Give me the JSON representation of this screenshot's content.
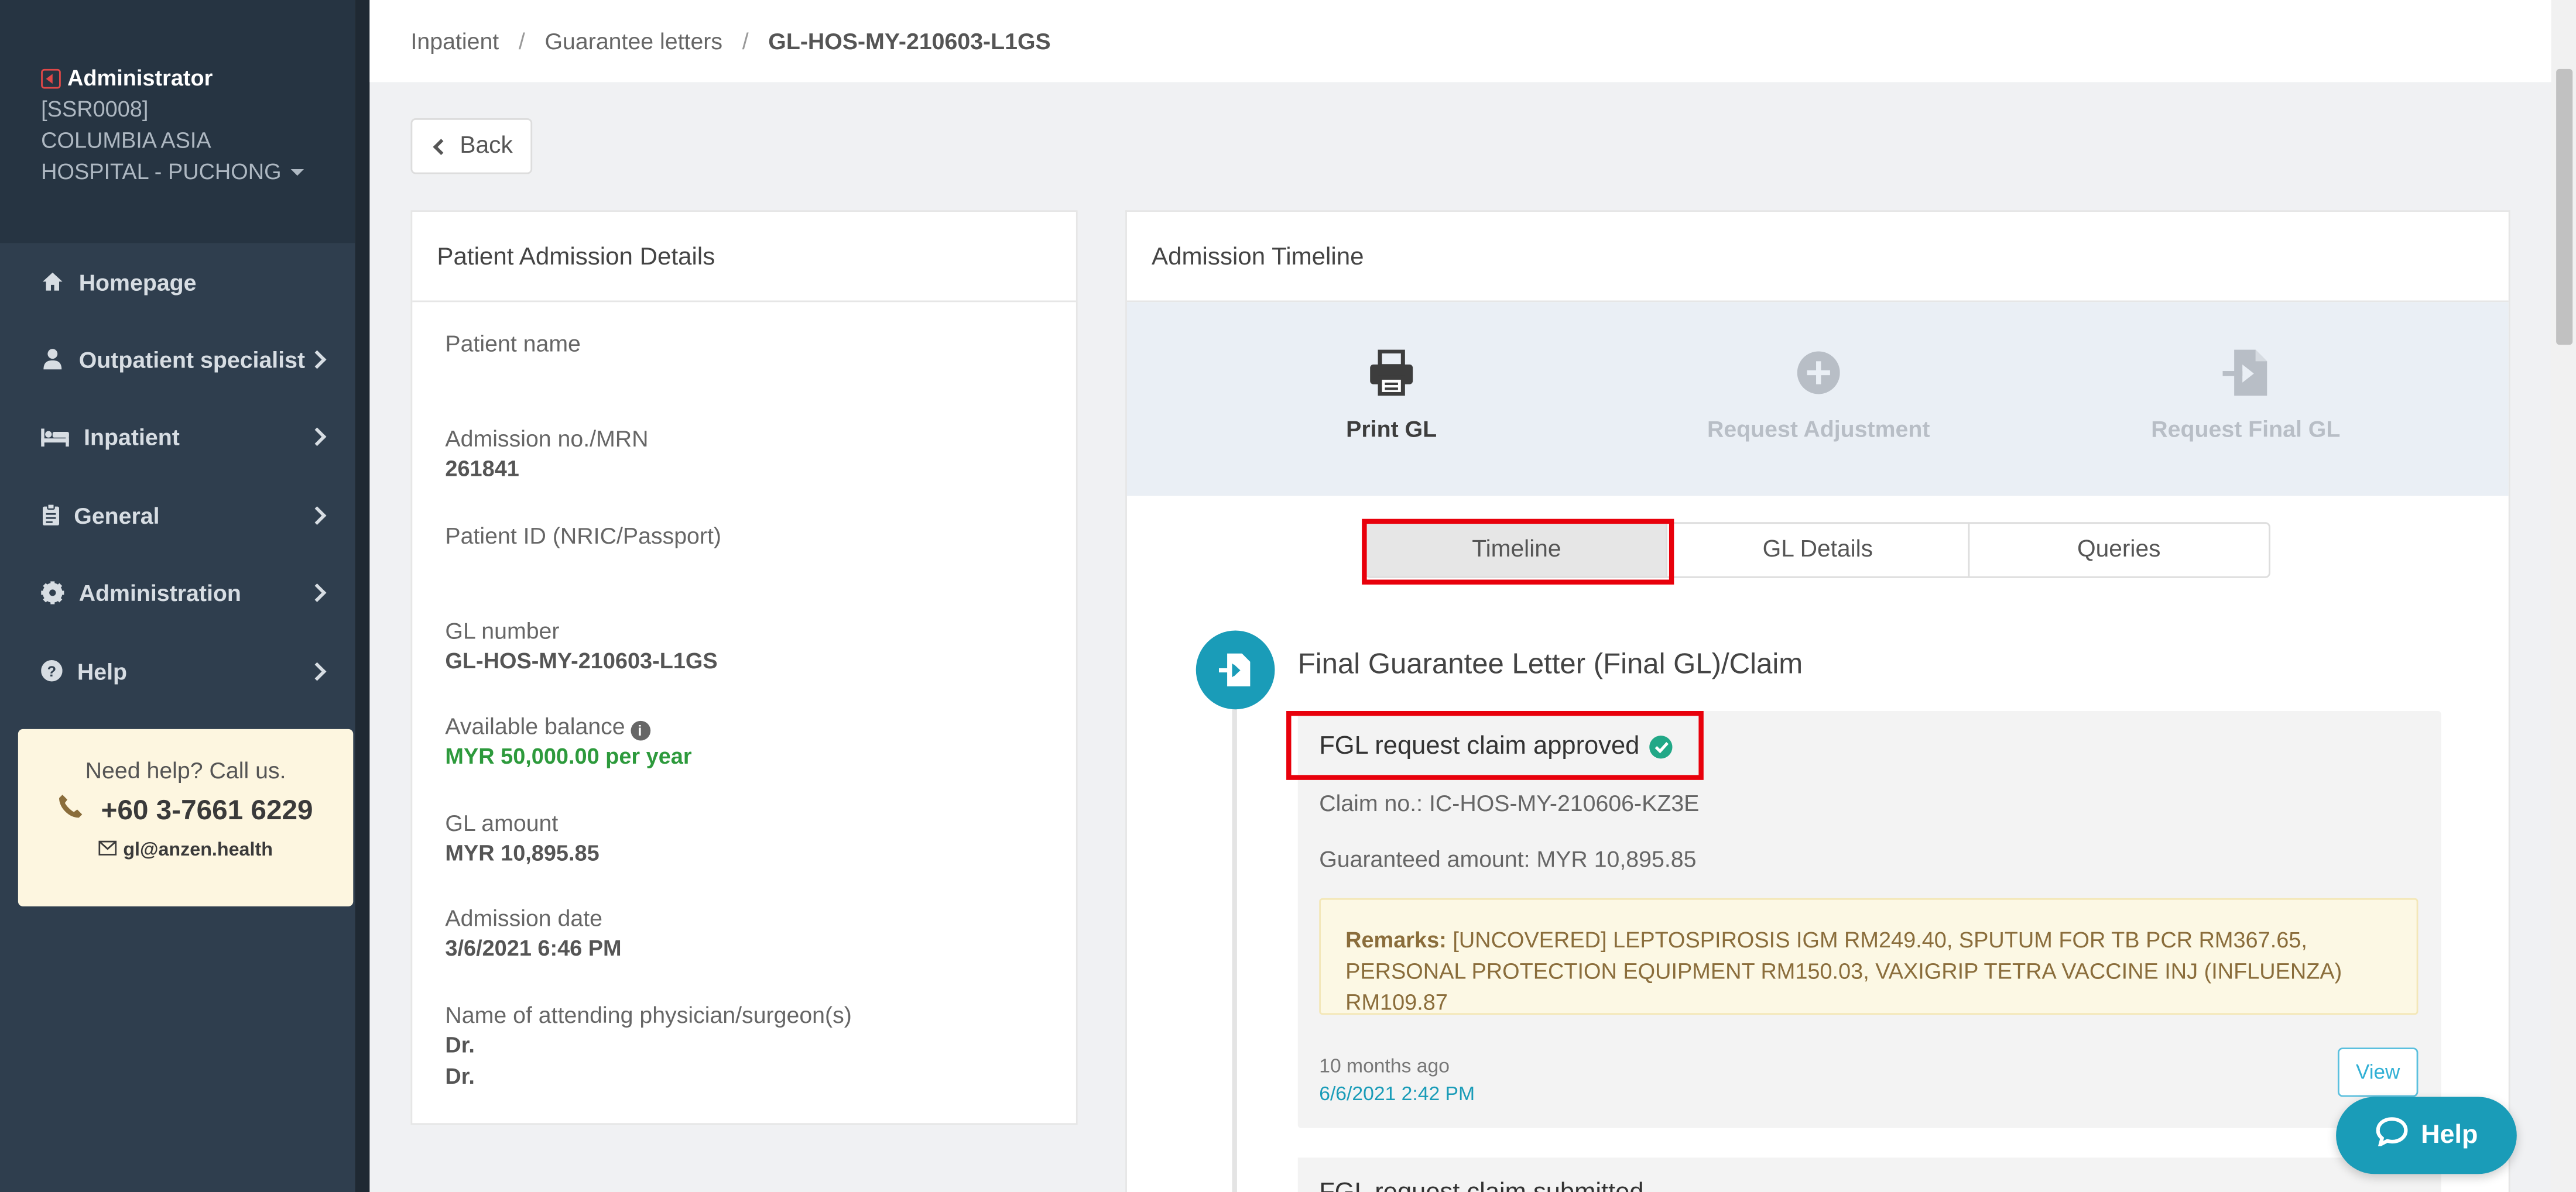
{
  "sidebar": {
    "user": {
      "name": "Administrator",
      "code": "[SSR0008]",
      "hospital": "COLUMBIA ASIA HOSPITAL - PUCHONG"
    },
    "items": [
      {
        "label": "Homepage",
        "icon": "home-icon"
      },
      {
        "label": "Outpatient specialist",
        "icon": "user-doctor-icon"
      },
      {
        "label": "Inpatient",
        "icon": "bed-icon"
      },
      {
        "label": "General",
        "icon": "clipboard-icon"
      },
      {
        "label": "Administration",
        "icon": "gear-icon"
      },
      {
        "label": "Help",
        "icon": "question-circle-icon"
      }
    ],
    "help_card": {
      "title": "Need help? Call us.",
      "phone": "+60 3-7661 6229",
      "email": "gl@anzen.health"
    }
  },
  "breadcrumb": {
    "items": [
      "Inpatient",
      "Guarantee letters"
    ],
    "current": "GL-HOS-MY-210603-L1GS"
  },
  "back_label": "Back",
  "patient": {
    "title": "Patient Admission Details",
    "fields": {
      "patient_name_label": "Patient name",
      "patient_name_value": "",
      "admission_label": "Admission no./MRN",
      "admission_value": "261841",
      "patient_id_label": "Patient ID (NRIC/Passport)",
      "patient_id_value": "",
      "gl_number_label": "GL number",
      "gl_number_value": "GL-HOS-MY-210603-L1GS",
      "balance_label": "Available balance",
      "balance_value": "MYR 50,000.00 per year",
      "gl_amount_label": "GL amount",
      "gl_amount_value": "MYR 10,895.85",
      "admission_date_label": "Admission date",
      "admission_date_value": "3/6/2021 6:46 PM",
      "physician_label": "Name of attending physician/surgeon(s)",
      "physician_1": "Dr.",
      "physician_2": "Dr."
    }
  },
  "timeline": {
    "title": "Admission Timeline",
    "actions": [
      {
        "label": "Print GL",
        "icon": "print-icon",
        "state": "active"
      },
      {
        "label": "Request Adjustment",
        "icon": "plus-circle-icon",
        "state": "disabled"
      },
      {
        "label": "Request Final GL",
        "icon": "file-import-icon",
        "state": "disabled"
      }
    ],
    "tabs": [
      "Timeline",
      "GL Details",
      "Queries"
    ],
    "active_tab": "Timeline",
    "section_title": "Final Guarantee Letter (Final GL)/Claim",
    "card": {
      "title": "FGL request claim approved",
      "claim_no": "Claim no.: IC-HOS-MY-210606-KZ3E",
      "guaranteed": "Guaranteed amount: MYR 10,895.85",
      "remarks_label": "Remarks:",
      "remarks_text": "[UNCOVERED] LEPTOSPIROSIS IGM RM249.40, SPUTUM FOR TB PCR RM367.65, PERSONAL PROTECTION EQUIPMENT RM150.03, VAXIGRIP TETRA VACCINE INJ (INFLUENZA) RM109.87",
      "ago": "10 months ago",
      "date": "6/6/2021 2:42 PM",
      "view_label": "View"
    },
    "next_card_title": "FGL request claim submitted"
  },
  "help_button": "Help",
  "colors": {
    "sidebar": "#2f3e4e",
    "accent": "#1a9cb8",
    "highlight": "#e8000b",
    "success": "#2d9a3c"
  }
}
